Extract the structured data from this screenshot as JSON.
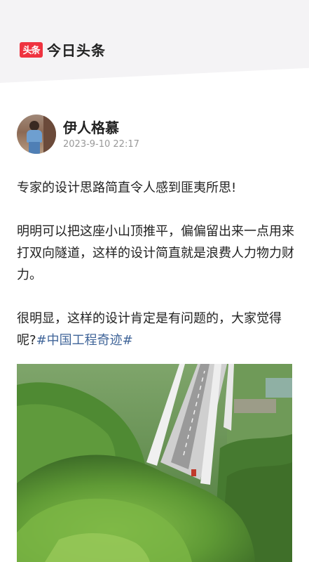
{
  "app": {
    "logo_text": "头条",
    "name": "今日头条",
    "brand_color": "#ef3340"
  },
  "post": {
    "author_name": "伊人格慕",
    "timestamp": "2023-9-10 22:17",
    "paragraph1": "专家的设计思路简直令人感到匪夷所思!",
    "paragraph2": "明明可以把这座小山顶推平，偏偏留出来一点用来打双向隧道，这样的设计简直就是浪费人力物力财力。",
    "paragraph3_text": "很明显，这样的设计肯定是有问题的，大家觉得呢?",
    "hashtag": "#中国工程奇迹#",
    "hashtag_color": "#406599"
  },
  "image": {
    "subject": "aerial-photo-bridge-over-green-mountain"
  }
}
